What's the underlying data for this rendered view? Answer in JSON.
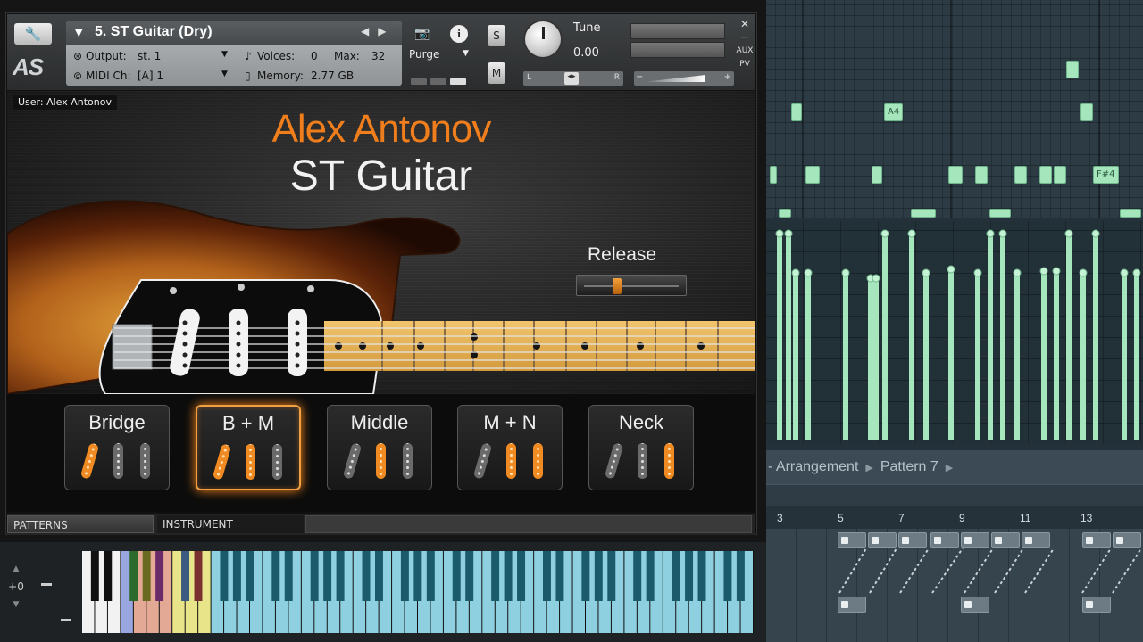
{
  "kontakt": {
    "instrument_name": "5. ST Guitar (Dry)",
    "output_label": "Output:",
    "output_value": "st. 1",
    "voices_label": "Voices:",
    "voices_value": "0",
    "max_label": "Max:",
    "max_value": "32",
    "midi_label": "MIDI Ch:",
    "midi_value": "[A] 1",
    "memory_label": "Memory:",
    "memory_value": "2.77 GB",
    "purge_label": "Purge",
    "solo_label": "S",
    "mute_label": "M",
    "tune_label": "Tune",
    "tune_value": "0.00",
    "pan_left": "L",
    "pan_right": "R",
    "vol_minus": "−",
    "vol_plus": "+",
    "aux_label": "AUX",
    "pv_label": "PV",
    "logo_text": "AS"
  },
  "instrument": {
    "user_label": "User: Alex Antonov",
    "brand": "Alex Antonov",
    "product": "ST Guitar",
    "release_label": "Release",
    "release_level": 0.33,
    "pickups": [
      {
        "label": "Bridge",
        "on": [
          1,
          0,
          0
        ],
        "active": false
      },
      {
        "label": "B + M",
        "on": [
          1,
          1,
          0
        ],
        "active": true
      },
      {
        "label": "Middle",
        "on": [
          0,
          1,
          0
        ],
        "active": false
      },
      {
        "label": "M + N",
        "on": [
          0,
          1,
          1
        ],
        "active": false
      },
      {
        "label": "Neck",
        "on": [
          0,
          0,
          1
        ],
        "active": false
      }
    ]
  },
  "tabs": {
    "patterns": "PATTERNS",
    "instrument": "INSTRUMENT"
  },
  "keyboard": {
    "octave_offset": "+0"
  },
  "fl": {
    "note_labels": [
      "A4",
      "F#4"
    ],
    "breadcrumb": [
      "- Arrangement",
      "Pattern 7"
    ],
    "ruler": [
      "3",
      "5",
      "7",
      "9",
      "11",
      "13"
    ]
  },
  "colors": {
    "accent_orange": "#f07e1c",
    "note_green": "#a5e6bc",
    "key_blue": "#8fd0e0"
  }
}
